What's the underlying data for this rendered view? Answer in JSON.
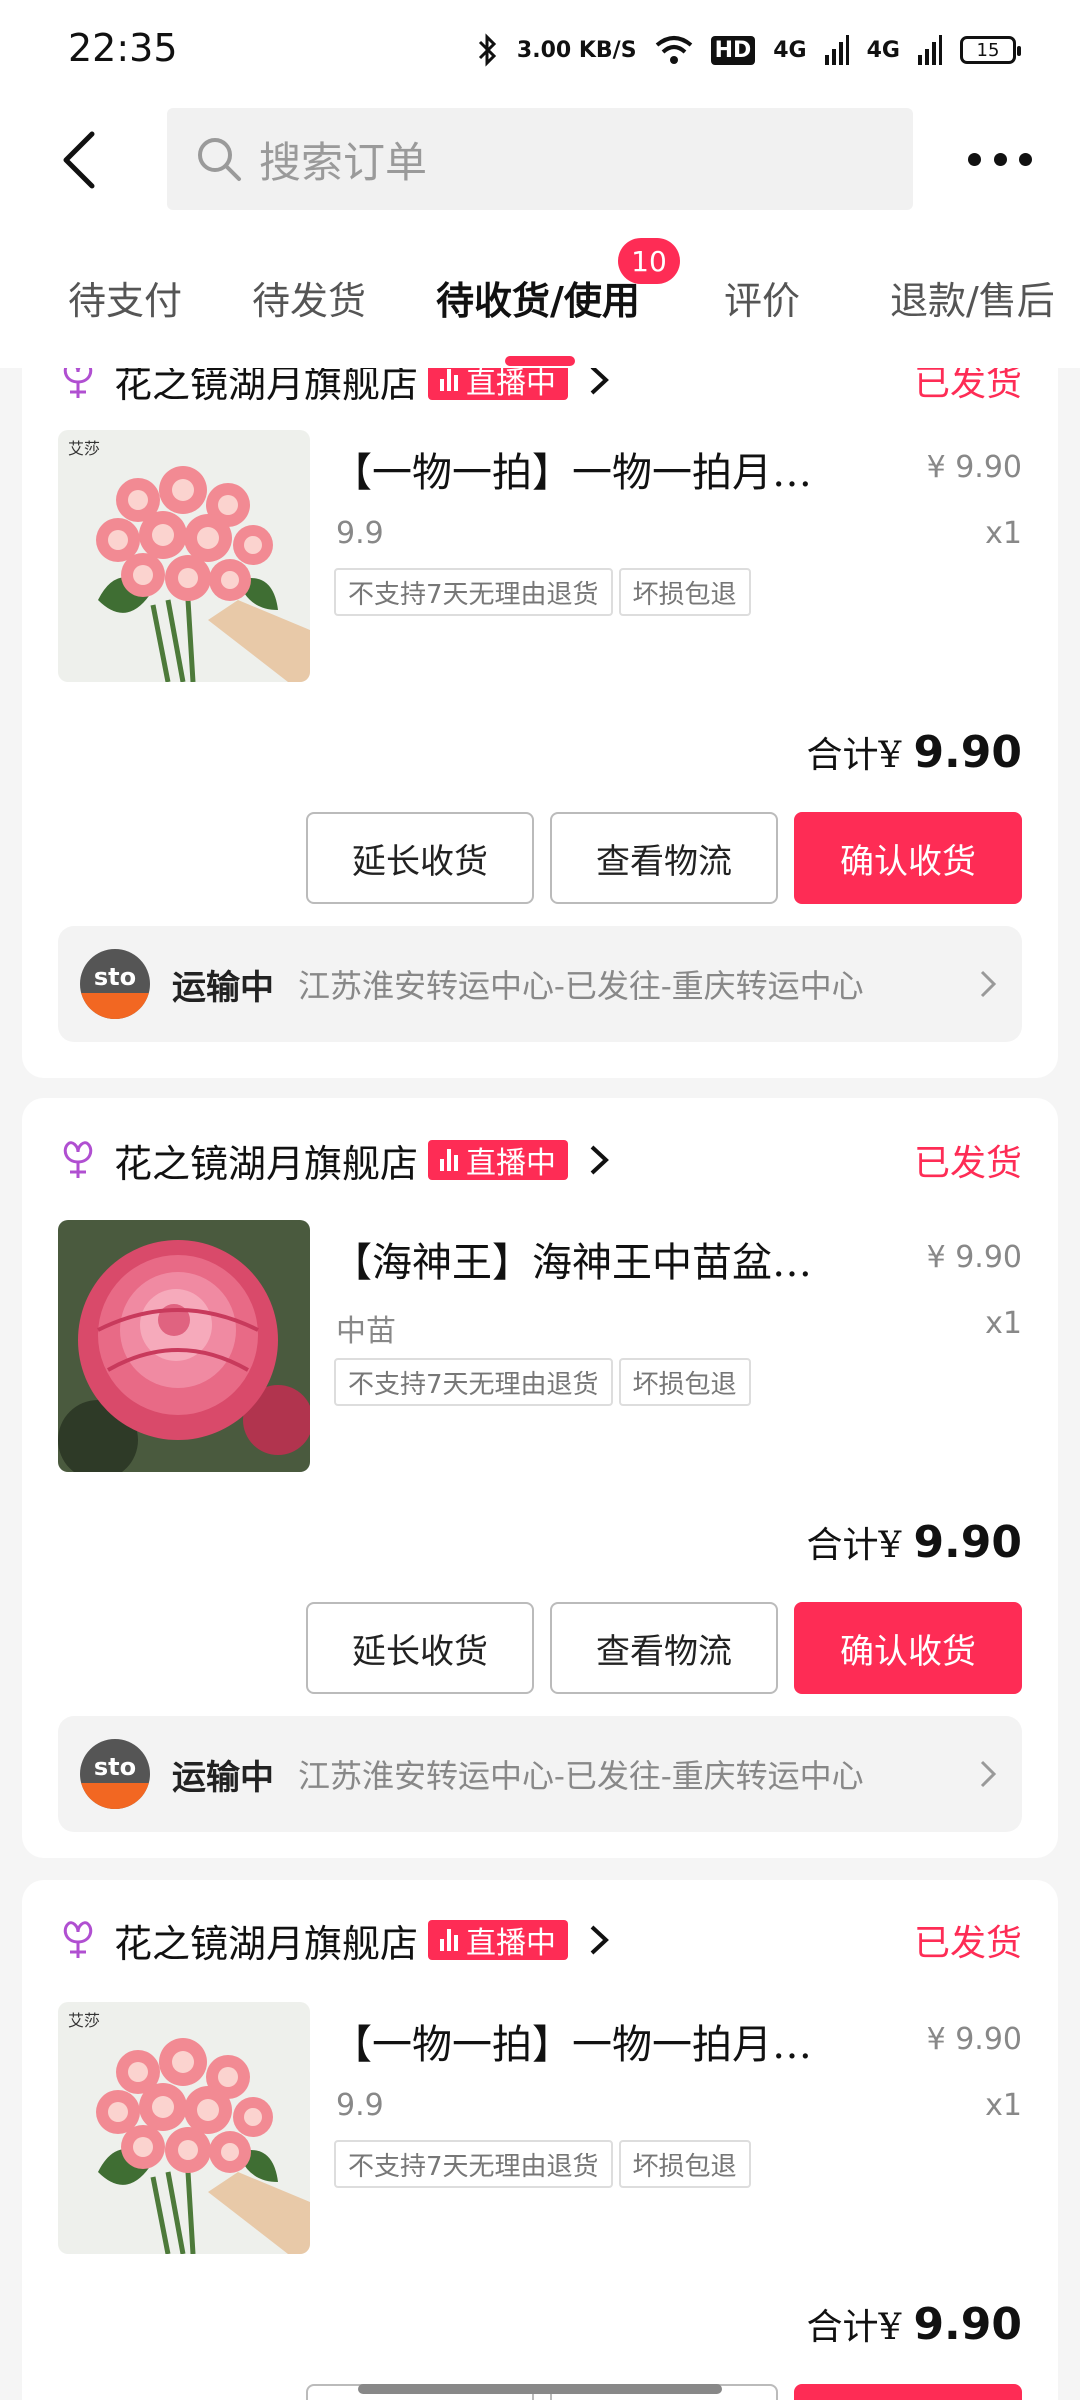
{
  "status_bar": {
    "time": "22:35",
    "net_speed": "3.00 KB/S",
    "hd_label": "HD",
    "signal1": "4G",
    "signal2": "4G",
    "battery": "15"
  },
  "search": {
    "placeholder": "搜索订单"
  },
  "tabs": [
    {
      "label": "待支付"
    },
    {
      "label": "待发货"
    },
    {
      "label": "待收货/使用",
      "badge": "10",
      "active": true
    },
    {
      "label": "评价"
    },
    {
      "label": "退款/售后"
    }
  ],
  "colors": {
    "accent": "#fe2c55",
    "bg": "#f5f5f5",
    "card": "#ffffff",
    "logistics_bg": "#f3f3f3"
  },
  "orders": [
    {
      "shop_name": "花之镜湖月旗舰店",
      "live_label": "直播中",
      "status": "已发货",
      "product_title": "【一物一拍】一物一拍月…",
      "price": "¥ 9.90",
      "spec": "9.9",
      "qty": "x1",
      "tags": [
        "不支持7天无理由退货",
        "坏损包退"
      ],
      "total_label": "合计¥",
      "total_value": "9.90",
      "buttons": [
        "延长收货",
        "查看物流",
        "确认收货"
      ],
      "logistics_status": "运输中",
      "logistics_desc": "江苏淮安转运中心-已发往-重庆转运中心",
      "image_label": "艾莎",
      "image": "pink-rose-bouquet"
    },
    {
      "shop_name": "花之镜湖月旗舰店",
      "live_label": "直播中",
      "status": "已发货",
      "product_title": "【海神王】海神王中苗盆…",
      "price": "¥ 9.90",
      "spec": "中苗",
      "qty": "x1",
      "tags": [
        "不支持7天无理由退货",
        "坏损包退"
      ],
      "total_label": "合计¥",
      "total_value": "9.90",
      "buttons": [
        "延长收货",
        "查看物流",
        "确认收货"
      ],
      "logistics_status": "运输中",
      "logistics_desc": "江苏淮安转运中心-已发往-重庆转运中心",
      "image": "single-pink-rose"
    },
    {
      "shop_name": "花之镜湖月旗舰店",
      "live_label": "直播中",
      "status": "已发货",
      "product_title": "【一物一拍】一物一拍月…",
      "price": "¥ 9.90",
      "spec": "9.9",
      "qty": "x1",
      "tags": [
        "不支持7天无理由退货",
        "坏损包退"
      ],
      "total_label": "合计¥",
      "total_value": "9.90",
      "image_label": "艾莎",
      "image": "pink-rose-bouquet"
    }
  ],
  "logistics_brand": "sto"
}
